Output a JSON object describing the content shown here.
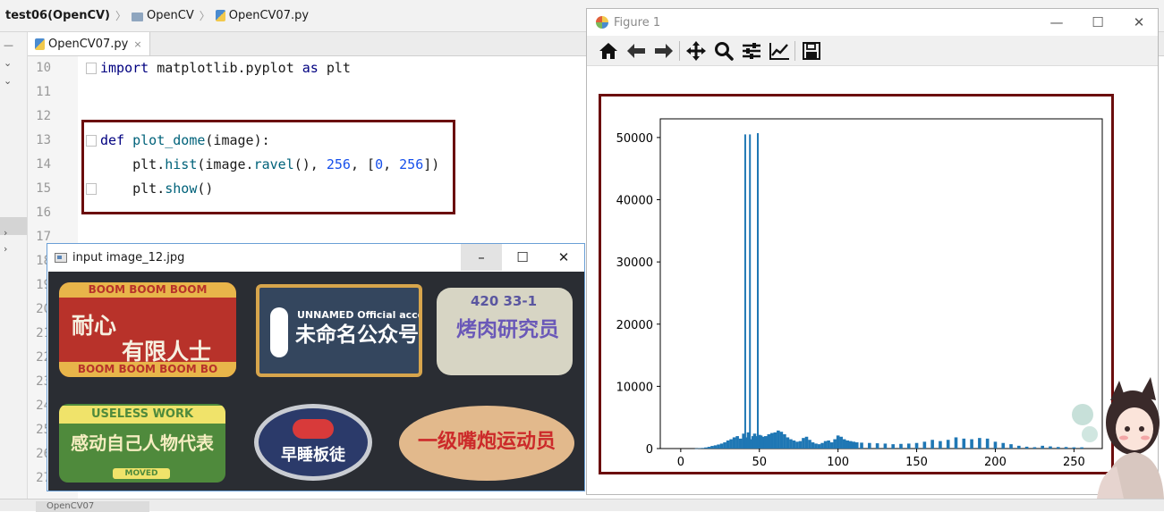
{
  "ide": {
    "breadcrumb": {
      "project": "test06(OpenCV)",
      "folder": "OpenCV",
      "file": "OpenCV07.py"
    },
    "tab": {
      "label": "OpenCV07.py",
      "close": "×"
    },
    "line_numbers": [
      "10",
      "11",
      "12",
      "13",
      "14",
      "15",
      "16",
      "17",
      "18",
      "19",
      "20",
      "21",
      "22",
      "23",
      "24",
      "25",
      "26",
      "27"
    ],
    "code": {
      "line_10": {
        "kw": "import",
        "rest": " matplotlib.pyplot ",
        "kw2": "as",
        "rest2": " plt"
      },
      "line_13": {
        "kw": "def",
        "name": " plot_dome",
        "rest": "(image):"
      },
      "line_14": {
        "pre": "    plt.",
        "fn": "hist",
        "a": "(image.",
        "fn2": "ravel",
        "b": "(), ",
        "n1": "256",
        "c": ", [",
        "n2": "0",
        "d": ", ",
        "n3": "256",
        "e": "])"
      },
      "line_15": {
        "pre": "    plt.",
        "fn": "show",
        "rest": "()"
      }
    },
    "status_tab": "OpenCV07"
  },
  "image_window": {
    "title": "input image_12.jpg",
    "controls": {
      "minimize": "–",
      "maximize": "☐",
      "close": "✕"
    },
    "badges": {
      "b1": {
        "band_top": "BOOM BOOM BOOM",
        "main": "耐心",
        "main2": "有限人士",
        "band_bottom": "BOOM BOOM BOOM BO"
      },
      "b2": {
        "top": "UNNAMED  Official account",
        "main": "未命名公众号"
      },
      "b3": {
        "top": "420  33-1",
        "main": "烤肉研究员"
      },
      "b4": {
        "top": "USELESS WORK",
        "main": "感动自己人物代表",
        "sub": "MOVED"
      },
      "b5": {
        "main": "早睡板徒"
      },
      "b6": {
        "main": "一级嘴炮运动员"
      }
    }
  },
  "figure_window": {
    "title": "Figure 1",
    "controls": {
      "minimize": "—",
      "maximize": "☐",
      "close": "✕"
    },
    "toolbar": [
      "home-icon",
      "back-icon",
      "forward-icon",
      "pan-icon",
      "zoom-icon",
      "configure-subplots-icon",
      "edit-axes-icon",
      "save-icon"
    ]
  },
  "chart_data": {
    "type": "bar",
    "title": "",
    "xlabel": "",
    "ylabel": "",
    "xlim": [
      -13,
      268
    ],
    "ylim": [
      0,
      53000
    ],
    "x_ticks": [
      0,
      50,
      100,
      150,
      200,
      250
    ],
    "y_ticks": [
      0,
      10000,
      20000,
      30000,
      40000,
      50000
    ],
    "bar_color": "#1f77b4",
    "series": [
      {
        "x": [
          10,
          12,
          14,
          16,
          18,
          20,
          22,
          24,
          26,
          28,
          30,
          32,
          34,
          36,
          38,
          40,
          41,
          42,
          43,
          44,
          45,
          46,
          47,
          48,
          49,
          50,
          51,
          52,
          54,
          56,
          58,
          60,
          62,
          64,
          66,
          68,
          70,
          72,
          74,
          76,
          78,
          80,
          82,
          84,
          86,
          88,
          90,
          92,
          94,
          96,
          98,
          100,
          102,
          104,
          106,
          108,
          110,
          112,
          115,
          120,
          125,
          130,
          135,
          140,
          145,
          150,
          155,
          160,
          165,
          170,
          175,
          180,
          185,
          190,
          195,
          200,
          205,
          210,
          215,
          220,
          225,
          230,
          235,
          240,
          245,
          250,
          255
        ],
        "values": [
          30,
          60,
          100,
          180,
          280,
          420,
          520,
          650,
          800,
          1000,
          1300,
          1500,
          1800,
          2000,
          1600,
          2400,
          50500,
          1800,
          2600,
          50500,
          1500,
          2000,
          2400,
          2000,
          50700,
          2200,
          2100,
          1900,
          2000,
          2300,
          2500,
          2600,
          2900,
          2700,
          2300,
          1800,
          1500,
          1300,
          1100,
          1200,
          1700,
          1900,
          1400,
          1000,
          800,
          700,
          900,
          1200,
          1300,
          1000,
          1500,
          2100,
          1900,
          1500,
          1300,
          1200,
          1100,
          1000,
          950,
          900,
          850,
          800,
          700,
          750,
          800,
          900,
          1100,
          1400,
          1200,
          1400,
          1800,
          1600,
          1500,
          1700,
          1600,
          1100,
          900,
          700,
          450,
          300,
          220,
          450,
          350,
          250,
          250,
          200,
          200
        ]
      }
    ]
  }
}
